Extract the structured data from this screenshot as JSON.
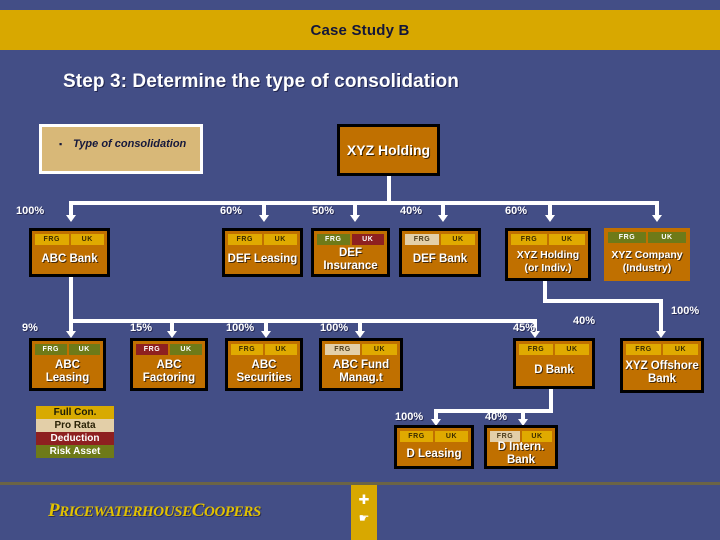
{
  "slide": {
    "title": "Case Study B",
    "step_title": "Step 3: Determine the type of consolidation",
    "bullet": {
      "marker": "▪",
      "text": "Type of consolidation"
    },
    "root": {
      "name": "XYZ Holding"
    }
  },
  "entities": [
    {
      "id": "abc_bank",
      "name": "ABC Bank",
      "pct": "100%",
      "flag_left": "FRG",
      "flag_right": "UK",
      "flag_left_style": "gold",
      "flag_right_style": "gold"
    },
    {
      "id": "def_leasing",
      "name": "DEF Leasing",
      "pct": "60%",
      "flag_left": "FRG",
      "flag_right": "UK",
      "flag_left_style": "gold",
      "flag_right_style": "gold"
    },
    {
      "id": "def_insurance",
      "name": "DEF Insurance",
      "pct": "50%",
      "flag_left": "FRG",
      "flag_right": "UK",
      "flag_left_style": "olive",
      "flag_right_style": "red"
    },
    {
      "id": "def_bank",
      "name": "DEF Bank",
      "pct": "40%",
      "flag_left": "FRG",
      "flag_right": "UK",
      "flag_left_style": "pale",
      "flag_right_style": "gold"
    },
    {
      "id": "xyz_holding_i",
      "name": "XYZ Holding (or Indiv.)",
      "pct": "60%",
      "flag_left": "FRG",
      "flag_right": "UK",
      "flag_left_style": "gold",
      "flag_right_style": "gold"
    },
    {
      "id": "xyz_company",
      "name": "XYZ Company (Industry)",
      "pct": "",
      "flag_left": "FRG",
      "flag_right": "UK",
      "flag_left_style": "olive",
      "flag_right_style": "olive"
    },
    {
      "id": "abc_leasing",
      "name": "ABC Leasing",
      "pct": "9%",
      "flag_left": "FRG",
      "flag_right": "UK",
      "flag_left_style": "olive",
      "flag_right_style": "olive"
    },
    {
      "id": "abc_factoring",
      "name": "ABC Factoring",
      "pct": "15%",
      "flag_left": "FRG",
      "flag_right": "UK",
      "flag_left_style": "red",
      "flag_right_style": "olive"
    },
    {
      "id": "abc_securities",
      "name": "ABC Securities",
      "pct": "100%",
      "flag_left": "FRG",
      "flag_right": "UK",
      "flag_left_style": "gold",
      "flag_right_style": "gold"
    },
    {
      "id": "abc_fund",
      "name": "ABC Fund Manag.t",
      "pct": "100%",
      "flag_left": "FRG",
      "flag_right": "UK",
      "flag_left_style": "pale",
      "flag_right_style": "gold"
    },
    {
      "id": "d_bank",
      "name": "D Bank",
      "pct": "45%",
      "flag_left": "FRG",
      "flag_right": "UK",
      "flag_left_style": "gold",
      "flag_right_style": "gold"
    },
    {
      "id": "xyz_offshore",
      "name": "XYZ Offshore Bank",
      "pct": "100%",
      "flag_left": "FRG",
      "flag_right": "UK",
      "flag_left_style": "gold",
      "flag_right_style": "gold"
    },
    {
      "id": "d_leasing",
      "name": "D Leasing",
      "pct": "100%",
      "flag_left": "FRG",
      "flag_right": "UK",
      "flag_left_style": "gold",
      "flag_right_style": "gold"
    },
    {
      "id": "d_intern_bank",
      "name": "D Intern. Bank",
      "pct": "40%",
      "flag_left": "FRG",
      "flag_right": "UK",
      "flag_left_style": "pale",
      "flag_right_style": "gold"
    }
  ],
  "extra_pcts": {
    "d_bank_branch": "40%",
    "offshore_branch": "100%"
  },
  "legend": [
    {
      "label": "Full Con.",
      "style": "lg-full"
    },
    {
      "label": "Pro Rata",
      "style": "lg-pro"
    },
    {
      "label": "Deduction",
      "style": "lg-ded"
    },
    {
      "label": "Risk Asset",
      "style": "lg-risk"
    }
  ],
  "footer": {
    "logo_part1": "P",
    "logo_part2": "RICEWATERHOUSE",
    "logo_part3": "C",
    "logo_part4": "OOPERS",
    "nav_prev": "✚",
    "nav_next": "☛"
  },
  "colors": {
    "background": "#434e86",
    "title_bar": "#d8a800",
    "box_fill": "#c07000",
    "box_border": "#000000",
    "line": "#ffffff",
    "flag_gold": "#e0aa00",
    "flag_pale": "#e3cfa8",
    "flag_red": "#8e2020",
    "flag_olive": "#6e7a18"
  }
}
